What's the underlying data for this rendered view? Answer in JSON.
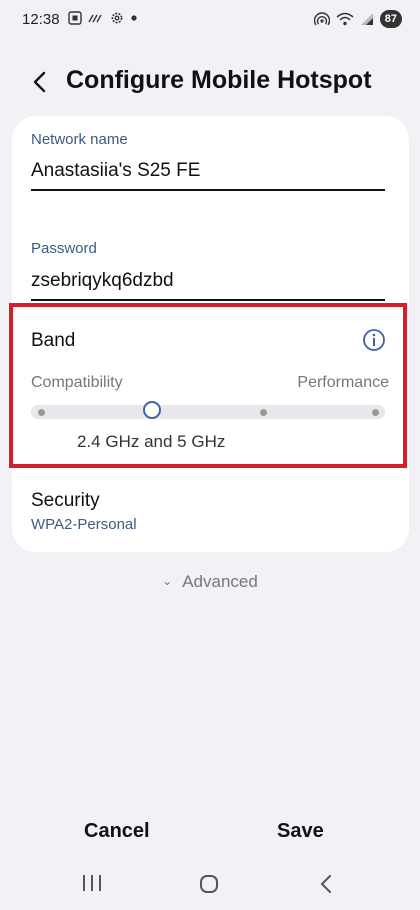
{
  "status_bar": {
    "time": "12:38",
    "battery": "87",
    "left_icons": [
      "screenshot-icon",
      "call-forwarding-icon",
      "settings-gear-icon",
      "notification-dot-icon"
    ],
    "right_icons": [
      "hotspot-icon",
      "wifi-icon",
      "signal-icon",
      "battery-icon"
    ]
  },
  "header": {
    "title": "Configure Mobile Hotspot",
    "back_icon": "chevron-left-icon"
  },
  "network": {
    "label": "Network name",
    "value": "Anastasiia's S25 FE"
  },
  "password": {
    "label": "Password",
    "value": "zsebriqykq6dzbd"
  },
  "band": {
    "title": "Band",
    "left_label": "Compatibility",
    "right_label": "Performance",
    "selected_value": "2.4 GHz and 5 GHz",
    "slider_positions": 4,
    "selected_index": 1
  },
  "security": {
    "title": "Security",
    "value": "WPA2-Personal"
  },
  "advanced": {
    "label": "Advanced"
  },
  "actions": {
    "cancel": "Cancel",
    "save": "Save"
  },
  "colors": {
    "background": "#f2f2f6",
    "accent_label": "#3d5a80",
    "highlight": "#d51f2b",
    "slider_thumb": "#3f63a8"
  }
}
